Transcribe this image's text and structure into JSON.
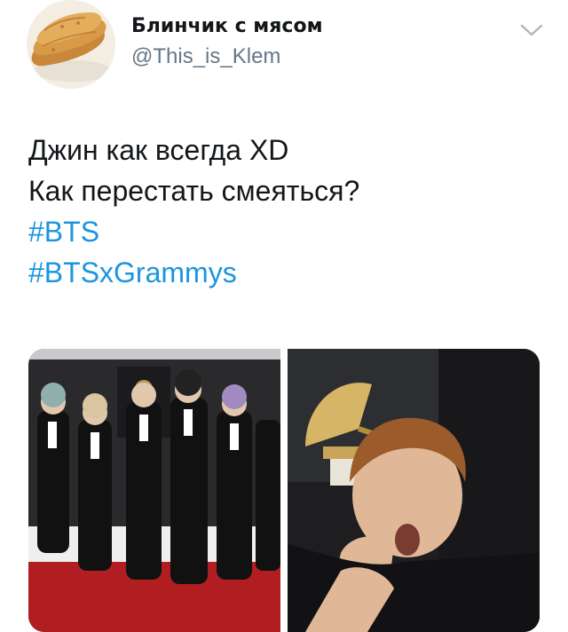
{
  "author": {
    "display_name": "Блинчик с мясом",
    "handle": "@This_is_Klem"
  },
  "icons": {
    "avatar": "pancakes-avatar",
    "menu": "chevron-down-icon"
  },
  "tweet": {
    "lines": [
      "Джин как всегда XD",
      "Как перестать смеяться?"
    ],
    "hashtags": [
      "#BTS",
      "#BTSxGrammys"
    ]
  },
  "media": {
    "count": 2,
    "images": [
      "group-photo-at-grammys",
      "closeup-reaction-with-gramophone-trophy"
    ]
  },
  "colors": {
    "text": "#14171a",
    "secondary": "#657786",
    "link": "#1b95e0",
    "carpet": "#b01e22"
  }
}
